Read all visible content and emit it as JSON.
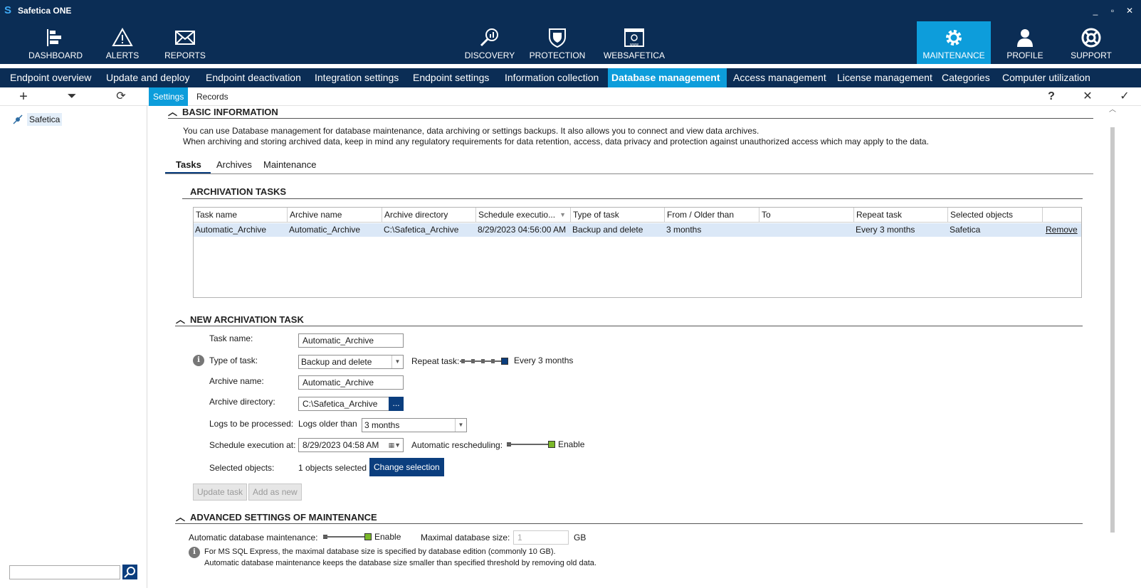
{
  "app": {
    "title": "Safetica ONE"
  },
  "window": {
    "minimize": "_",
    "maximize": "▫",
    "close": "✕"
  },
  "nav": {
    "dashboard": "DASHBOARD",
    "alerts": "ALERTS",
    "reports": "REPORTS",
    "discovery": "DISCOVERY",
    "protection": "PROTECTION",
    "websafetica": "WEBSAFETICA",
    "maintenance": "MAINTENANCE",
    "profile": "PROFILE",
    "support": "SUPPORT"
  },
  "subnav": {
    "items": [
      "Endpoint overview",
      "Update and deploy",
      "Endpoint deactivation",
      "Integration settings",
      "Endpoint settings",
      "Information collection",
      "Database management",
      "Access management",
      "License management",
      "Categories",
      "Computer utilization"
    ],
    "active": "Database management"
  },
  "toolbar": {
    "add": "+",
    "filter": "⏷",
    "refresh": "⟳",
    "settings_tab": "Settings",
    "records_tab": "Records",
    "help": "?",
    "cancel": "✕",
    "confirm": "✓"
  },
  "tree": {
    "root": "Safetica"
  },
  "basic": {
    "heading": "BASIC INFORMATION",
    "line1": "You can use Database management for database maintenance, data archiving or settings backups. It also allows you to connect and view data archives.",
    "line2": "When archiving and storing archived data, keep in mind any regulatory requirements for data retention, access, data privacy and protection against unauthorized access which may apply to the data."
  },
  "subtabs": {
    "tasks": "Tasks",
    "archives": "Archives",
    "maintenance": "Maintenance"
  },
  "archivation": {
    "heading": "ARCHIVATION TASKS",
    "columns": [
      "Task name",
      "Archive name",
      "Archive directory",
      "Schedule executio...",
      "Type of task",
      "From / Older than",
      "To",
      "Repeat task",
      "Selected objects",
      ""
    ],
    "rows": [
      [
        "Automatic_Archive",
        "Automatic_Archive",
        "C:\\Safetica_Archive",
        "8/29/2023 04:56:00 AM",
        "Backup and delete",
        "3 months",
        "",
        "Every 3 months",
        "Safetica",
        "Remove"
      ]
    ]
  },
  "newtask": {
    "heading": "NEW ARCHIVATION TASK",
    "task_name_label": "Task name:",
    "task_name_value": "Automatic_Archive",
    "type_label": "Type of task:",
    "type_value": "Backup and delete",
    "repeat_label": "Repeat task:",
    "repeat_value": "Every 3 months",
    "archive_name_label": "Archive name:",
    "archive_name_value": "Automatic_Archive",
    "archive_dir_label": "Archive directory:",
    "archive_dir_value": "C:\\Safetica_Archive",
    "browse": "...",
    "logs_label": "Logs to be processed:",
    "logs_prefix": "Logs older than",
    "logs_value": "3 months",
    "schedule_label": "Schedule execution at:",
    "schedule_value": "8/29/2023 04:58 AM",
    "resched_label": "Automatic rescheduling:",
    "resched_value": "Enable",
    "selected_label": "Selected objects:",
    "selected_value": "1 objects selected",
    "change_selection": "Change selection",
    "update_task": "Update task",
    "add_as_new": "Add as new"
  },
  "advanced": {
    "heading": "ADVANCED SETTINGS OF MAINTENANCE",
    "auto_label": "Automatic database maintenance:",
    "auto_value": "Enable",
    "max_label": "Maximal database size:",
    "max_value": "1",
    "max_unit": "GB",
    "note1": "For MS SQL Express, the maximal database size is specified by database edition (commonly 10 GB).",
    "note2": "Automatic database maintenance keeps the database size smaller than specified threshold by removing old data."
  },
  "colors": {
    "navy": "#0b2d55",
    "accent": "#0d9ddb",
    "button": "#0b3e7e",
    "toggle_on": "#7ab829"
  }
}
